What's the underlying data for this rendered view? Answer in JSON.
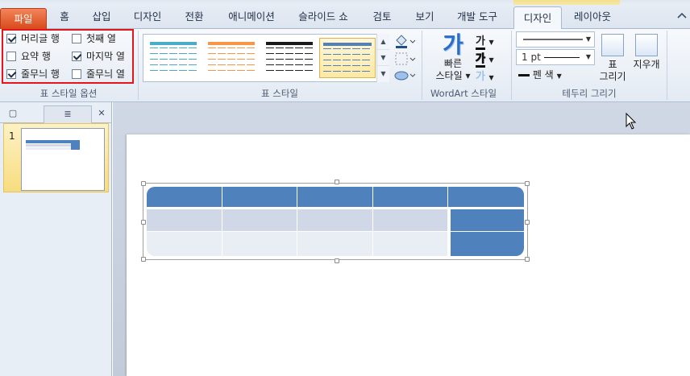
{
  "tabs": [
    {
      "label": "파일",
      "active": false,
      "special": "file"
    },
    {
      "label": "홈"
    },
    {
      "label": "삽입"
    },
    {
      "label": "디자인"
    },
    {
      "label": "전환"
    },
    {
      "label": "애니메이션"
    },
    {
      "label": "슬라이드 쇼"
    },
    {
      "label": "검토"
    },
    {
      "label": "보기"
    },
    {
      "label": "개발 도구"
    },
    {
      "label": "디자인",
      "active": true
    },
    {
      "label": "레이아웃"
    }
  ],
  "table_style_options": {
    "group_label": "표 스타일 옵션",
    "options": [
      {
        "label": "머리글 행",
        "checked": true
      },
      {
        "label": "첫째 열",
        "checked": false
      },
      {
        "label": "요약 행",
        "checked": false
      },
      {
        "label": "마지막 열",
        "checked": true
      },
      {
        "label": "줄무늬 행",
        "checked": true
      },
      {
        "label": "줄무늬 열",
        "checked": false
      }
    ]
  },
  "table_styles": {
    "group_label": "표 스타일",
    "swatches": [
      {
        "name": "teal-style",
        "color": "#4aacc6"
      },
      {
        "name": "orange-style",
        "color": "#f79646"
      },
      {
        "name": "black-style",
        "color": "#1a1a1a"
      },
      {
        "name": "blue-style",
        "color": "#4f81bd",
        "selected": true
      }
    ]
  },
  "wordart": {
    "group_label": "WordArt 스타일",
    "quick_styles_label_1": "빠른",
    "quick_styles_label_2": "스타일",
    "glyph": "가",
    "text_fill_glyph": "가",
    "outline_glyph": "가",
    "effect_glyph": "가"
  },
  "draw_borders": {
    "group_label": "테두리 그리기",
    "pen_weight": "1 pt",
    "pen_color_label": "펜 색",
    "draw_table_label_1": "표",
    "draw_table_label_2": "그리기",
    "eraser_label": "지우개"
  },
  "slides": [
    {
      "number": "1"
    }
  ],
  "colors": {
    "header": "#4f81bd",
    "band_dark": "#d0d8e8",
    "band_light": "#e9edf4",
    "highlight": "#e5161b"
  }
}
